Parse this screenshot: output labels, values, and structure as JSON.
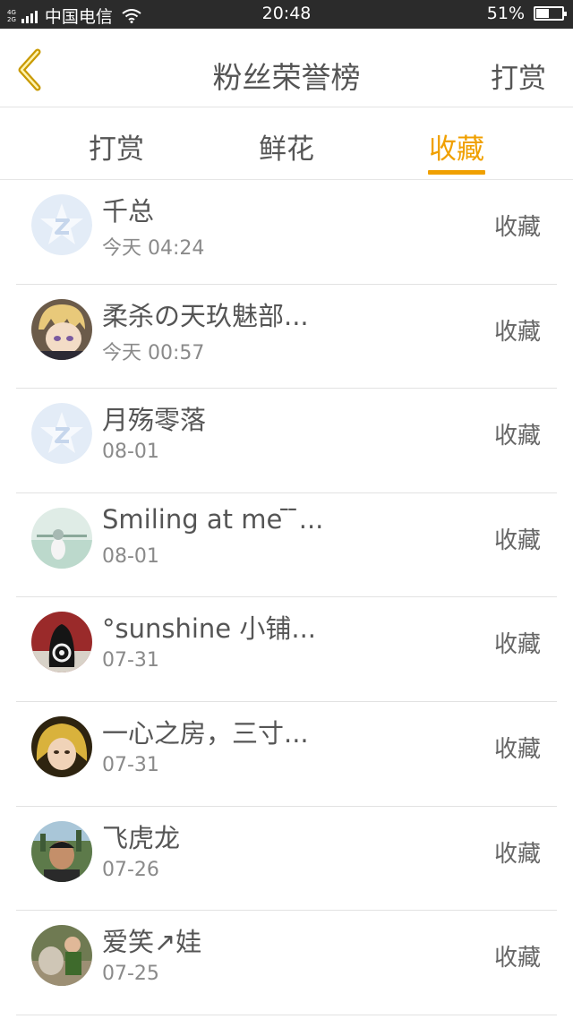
{
  "status_bar": {
    "net_top": "4G",
    "net_bottom": "2G",
    "carrier": "中国电信",
    "time": "20:48",
    "battery_percent": "51%",
    "battery_level": 0.51
  },
  "header": {
    "back_icon": "chevron-left-icon",
    "title": "粉丝荣誉榜",
    "action_label": "打赏"
  },
  "tabs": [
    {
      "label": "打赏"
    },
    {
      "label": "鲜花"
    },
    {
      "label": "收藏"
    }
  ],
  "active_tab": 2,
  "accent_color": "#f0a000",
  "fans": [
    {
      "name": "千总",
      "date": "今天 04:24",
      "action": "收藏"
    },
    {
      "name": "柔杀の天玖魅部...",
      "date": "今天 00:57",
      "action": "收藏"
    },
    {
      "name": "月殇零落",
      "date": "08-01",
      "action": "收藏"
    },
    {
      "name": "Smiling at me ̄ ̄...",
      "date": "08-01",
      "action": "收藏"
    },
    {
      "name": "°sunshine 小铺...",
      "date": "07-31",
      "action": "收藏"
    },
    {
      "name": "一心之房，三寸...",
      "date": "07-31",
      "action": "收藏"
    },
    {
      "name": "飞虎龙",
      "date": "07-26",
      "action": "收藏"
    },
    {
      "name": "爱笑↗娃",
      "date": "07-25",
      "action": "收藏"
    }
  ]
}
